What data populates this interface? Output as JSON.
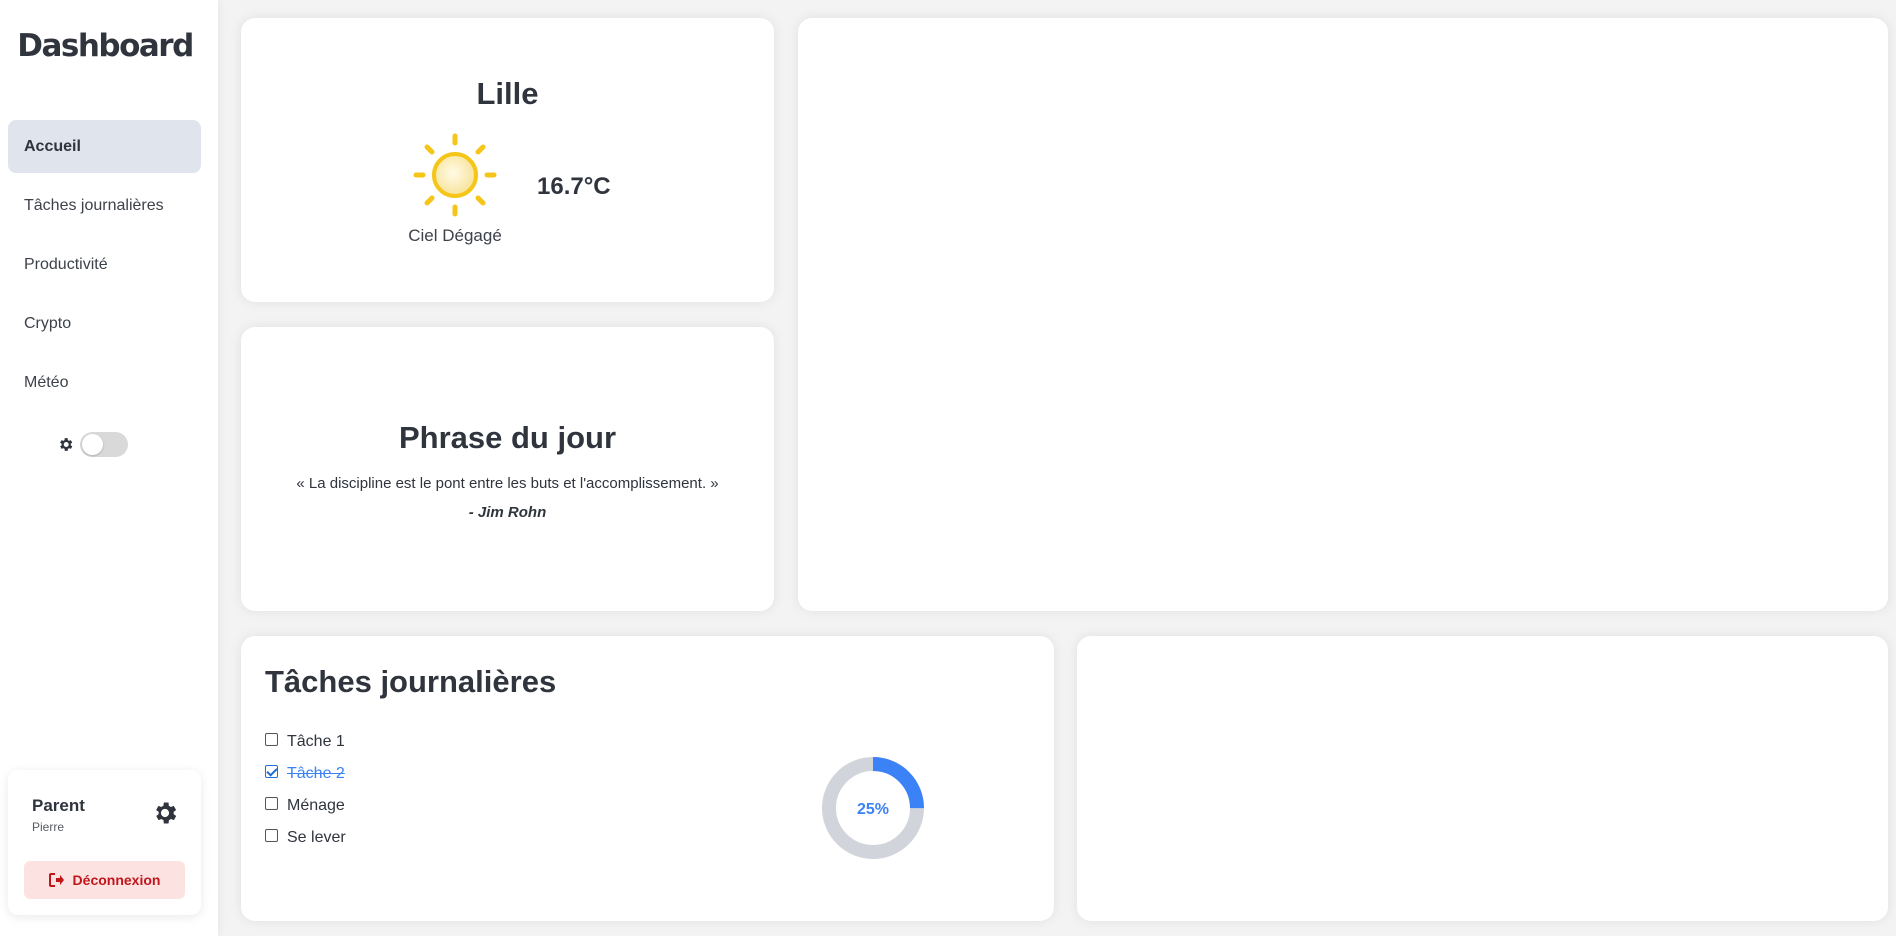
{
  "app": {
    "title": "Dashboard"
  },
  "sidebar": {
    "items": [
      {
        "label": "Accueil",
        "active": true
      },
      {
        "label": "Tâches journalières"
      },
      {
        "label": "Productivité"
      },
      {
        "label": "Crypto"
      },
      {
        "label": "Météo"
      }
    ],
    "theme_toggle": {
      "on": false,
      "icon": "gear-icon"
    }
  },
  "user": {
    "role": "Parent",
    "name": "Pierre",
    "settings_icon": "gear-icon",
    "logout_label": "Déconnexion",
    "logout_icon": "logout-icon"
  },
  "weather": {
    "city": "Lille",
    "temperature": "16.7°C",
    "condition": "Ciel Dégagé",
    "icon": "sun-icon"
  },
  "quote": {
    "title": "Phrase du jour",
    "text": "« La discipline est le pont entre les buts et l'accomplissement. »",
    "author": "- Jim Rohn"
  },
  "tasks": {
    "title": "Tâches journalières",
    "items": [
      {
        "label": "Tâche 1",
        "done": false
      },
      {
        "label": "Tâche 2",
        "done": true
      },
      {
        "label": "Ménage",
        "done": false
      },
      {
        "label": "Se lever",
        "done": false
      }
    ],
    "progress": {
      "percent": 25,
      "label": "25%"
    }
  },
  "colors": {
    "accent": "#3b82f6",
    "track": "#d1d5db",
    "active_nav": "#dfe4ed",
    "logout_bg": "#fde2e2",
    "logout_text": "#c0161b",
    "sun": "#f5c518"
  }
}
